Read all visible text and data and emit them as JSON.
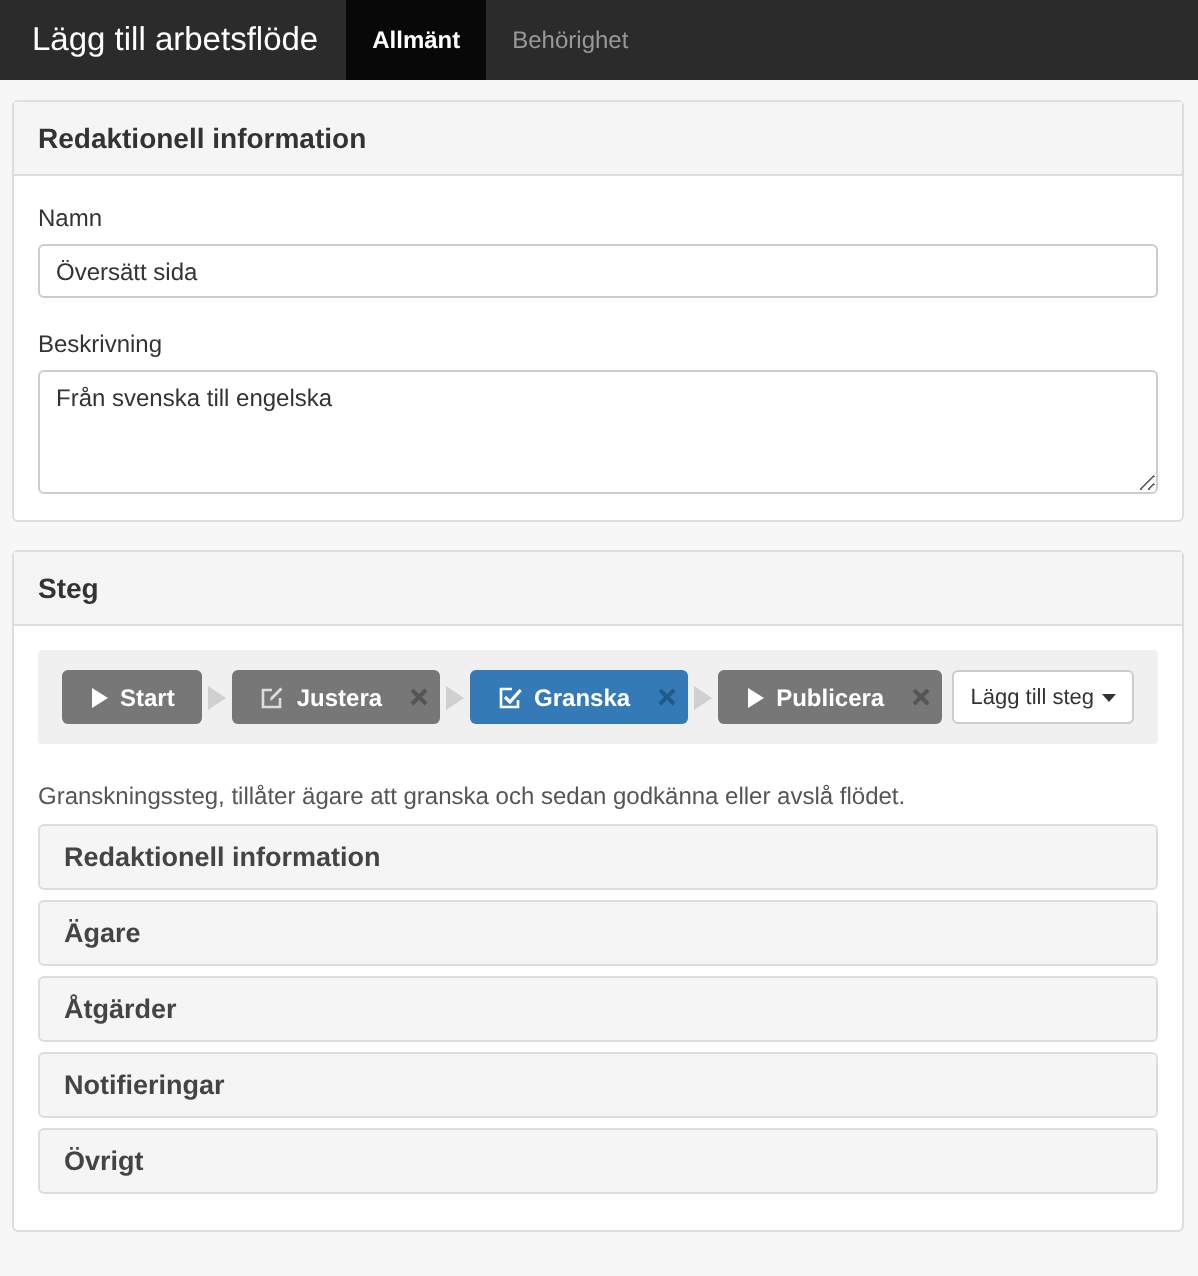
{
  "navbar": {
    "brand": "Lägg till arbetsflöde",
    "tabs": [
      {
        "label": "Allmänt",
        "selected": true
      },
      {
        "label": "Behörighet",
        "selected": false
      }
    ]
  },
  "info_panel": {
    "title": "Redaktionell information",
    "fields": [
      {
        "kind": "input",
        "label": "Namn",
        "value": "Översätt sida"
      },
      {
        "kind": "textarea",
        "label": "Beskrivning",
        "value": "Från svenska till engelska"
      }
    ]
  },
  "steps_panel": {
    "title": "Steg",
    "steps": [
      {
        "label": "Start",
        "kind": "start",
        "removable": false,
        "selected": false
      },
      {
        "label": "Justera",
        "kind": "edit",
        "removable": true,
        "selected": false
      },
      {
        "label": "Granska",
        "kind": "review",
        "removable": true,
        "selected": true
      },
      {
        "label": "Publicera",
        "kind": "publish",
        "removable": true,
        "selected": false
      }
    ],
    "add_button": "Lägg till steg",
    "description": "Granskningssteg, tillåter ägare att granska och sedan godkänna eller avslå flödet.",
    "sections": [
      {
        "title": "Redaktionell information",
        "expanded": false
      },
      {
        "title": "Ägare",
        "expanded": false
      },
      {
        "title": "Åtgärder",
        "expanded": false
      },
      {
        "title": "Notifieringar",
        "expanded": false
      },
      {
        "title": "Övrigt",
        "expanded": false
      }
    ]
  }
}
